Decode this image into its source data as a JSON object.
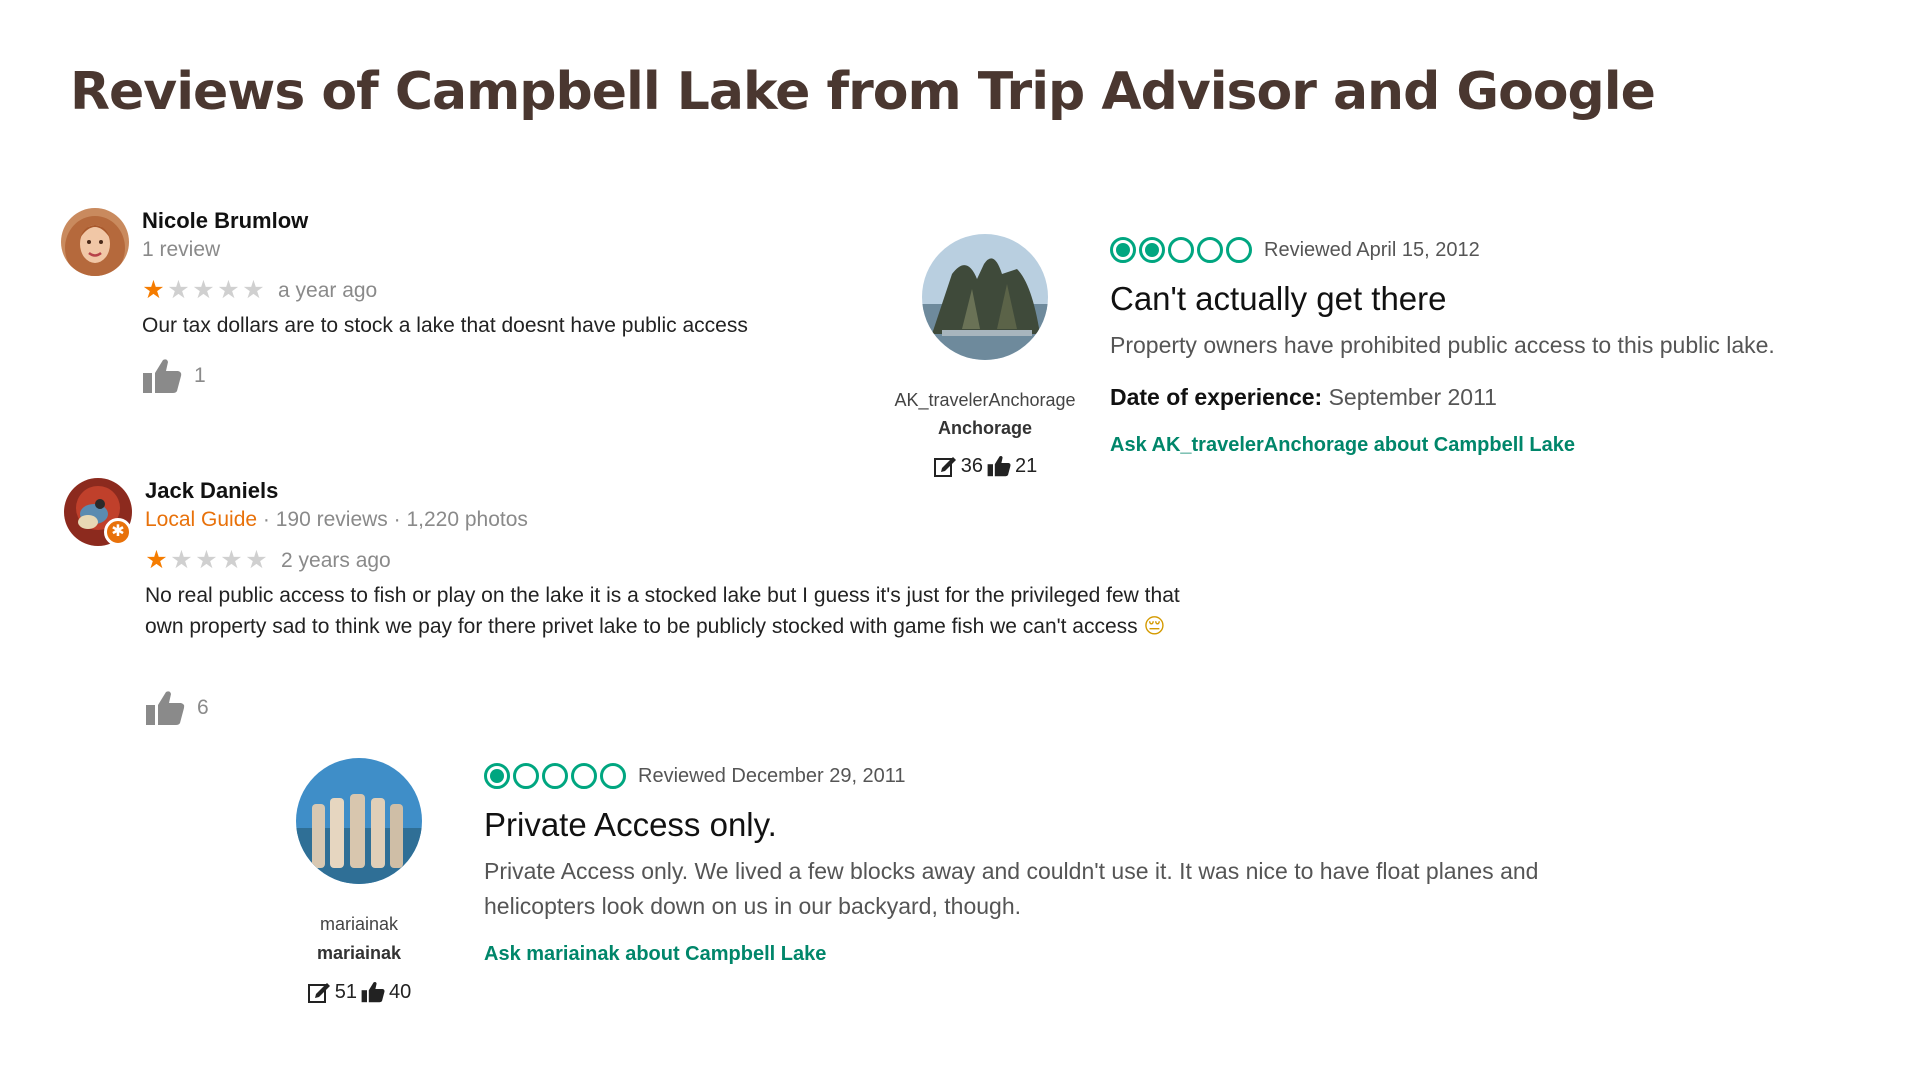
{
  "slide": {
    "title": "Reviews of Campbell Lake from Trip Advisor and Google"
  },
  "colors": {
    "title": "#4a3730",
    "star_on": "#f57c00",
    "star_off": "#d0d0d0",
    "tripadvisor_green": "#00a680",
    "link_green": "#00866a",
    "local_guide": "#e8710a"
  },
  "google_reviews": [
    {
      "name": "Nicole Brumlow",
      "meta": "1 review",
      "rating": 1,
      "rating_max": 5,
      "time": "a year ago",
      "text": "Our tax dollars are to stock a lake that doesnt have public access",
      "likes": "1",
      "icon": "thumbs-up-icon"
    },
    {
      "name": "Jack Daniels",
      "badge": "Local Guide",
      "meta": " · 190 reviews · 1,220 photos",
      "rating": 1,
      "rating_max": 5,
      "time": "2 years ago",
      "text": "No real public access to fish or play on the lake it is a stocked lake but I guess it's just for the privileged few that own property sad to think we pay for there privet lake to be publicly stocked with game fish we can't access",
      "emoji": "😔",
      "likes": "6",
      "icon": "thumbs-up-icon"
    }
  ],
  "tripadvisor_reviews": [
    {
      "username": "AK_travelerAnchorage",
      "location": "Anchorage",
      "contributions": "36",
      "helpful_votes": "21",
      "bubbles": 2,
      "bubbles_max": 5,
      "reviewed": "Reviewed April 15, 2012",
      "title": "Can't actually get there",
      "body": "Property owners have prohibited public access to this public lake.",
      "experience_label": "Date of experience:",
      "experience_value": " September 2011",
      "ask": "Ask AK_travelerAnchorage about Campbell Lake"
    },
    {
      "username": "mariainak",
      "location": "mariainak",
      "contributions": "51",
      "helpful_votes": "40",
      "bubbles": 1,
      "bubbles_max": 5,
      "reviewed": "Reviewed December 29, 2011",
      "title": "Private Access only.",
      "body": "Private Access only. We lived a few blocks away and couldn't use it. It was nice to have float planes and helicopters look down on us in our backyard, though.",
      "ask": "Ask mariainak about Campbell Lake"
    }
  ]
}
